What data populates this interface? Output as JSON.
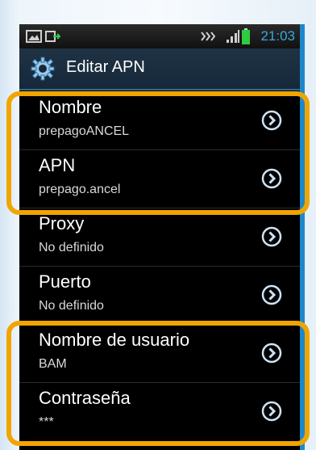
{
  "status_bar": {
    "time": "21:03"
  },
  "app_bar": {
    "title": "Editar APN"
  },
  "fields": [
    {
      "label": "Nombre",
      "value": "prepagoANCEL"
    },
    {
      "label": "APN",
      "value": "prepago.ancel"
    },
    {
      "label": "Proxy",
      "value": "No definido"
    },
    {
      "label": "Puerto",
      "value": "No definido"
    },
    {
      "label": "Nombre de usuario",
      "value": "BAM"
    },
    {
      "label": "Contraseña",
      "value": "***"
    }
  ],
  "colors": {
    "highlight": "#f0a500",
    "accent": "#36a9e1",
    "background": "#000000"
  },
  "icons": {
    "settings": "gear-icon",
    "chevron": "chevron-right-circle-icon",
    "gallery": "gallery-icon",
    "usb": "usb-icon",
    "signal": "signal-icon",
    "battery": "battery-icon",
    "vibrate": "vibrate-icon"
  }
}
